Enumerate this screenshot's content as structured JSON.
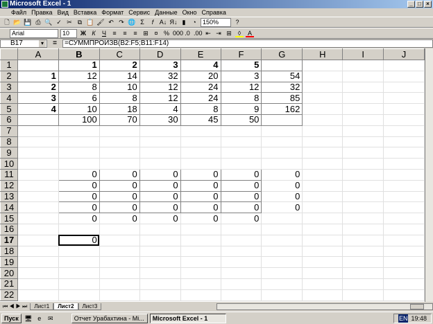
{
  "window": {
    "title": "Microsoft Excel - 1"
  },
  "menu": [
    "Файл",
    "Правка",
    "Вид",
    "Вставка",
    "Формат",
    "Сервис",
    "Данные",
    "Окно",
    "Справка"
  ],
  "toolbar": {
    "zoom": "150%",
    "font": "Arial",
    "font_size": "10"
  },
  "formula_bar": {
    "name_box": "B17",
    "eq": "=",
    "formula": "=СУММПРОИЗВ(B2:F5;B11:F14)"
  },
  "columns": [
    "A",
    "B",
    "C",
    "D",
    "E",
    "F",
    "G",
    "H",
    "I",
    "J"
  ],
  "rows": [
    [
      "",
      "1",
      "2",
      "3",
      "4",
      "5",
      "",
      "",
      "",
      ""
    ],
    [
      "1",
      "12",
      "14",
      "32",
      "20",
      "3",
      "54",
      "",
      "",
      ""
    ],
    [
      "2",
      "8",
      "10",
      "12",
      "24",
      "12",
      "32",
      "",
      "",
      ""
    ],
    [
      "3",
      "6",
      "8",
      "12",
      "24",
      "8",
      "85",
      "",
      "",
      ""
    ],
    [
      "4",
      "10",
      "18",
      "4",
      "8",
      "9",
      "162",
      "",
      "",
      ""
    ],
    [
      "",
      "100",
      "70",
      "30",
      "45",
      "50",
      "",
      "",
      "",
      ""
    ],
    [
      "",
      "",
      "",
      "",
      "",
      "",
      "",
      "",
      "",
      ""
    ],
    [
      "",
      "",
      "",
      "",
      "",
      "",
      "",
      "",
      "",
      ""
    ],
    [
      "",
      "",
      "",
      "",
      "",
      "",
      "",
      "",
      "",
      ""
    ],
    [
      "",
      "",
      "",
      "",
      "",
      "",
      "",
      "",
      "",
      ""
    ],
    [
      "",
      "0",
      "0",
      "0",
      "0",
      "0",
      "0",
      "",
      "",
      ""
    ],
    [
      "",
      "0",
      "0",
      "0",
      "0",
      "0",
      "0",
      "",
      "",
      ""
    ],
    [
      "",
      "0",
      "0",
      "0",
      "0",
      "0",
      "0",
      "",
      "",
      ""
    ],
    [
      "",
      "0",
      "0",
      "0",
      "0",
      "0",
      "0",
      "",
      "",
      ""
    ],
    [
      "",
      "0",
      "0",
      "0",
      "0",
      "0",
      "",
      "",
      "",
      ""
    ],
    [
      "",
      "",
      "",
      "",
      "",
      "",
      "",
      "",
      "",
      ""
    ],
    [
      "",
      "0",
      "",
      "",
      "",
      "",
      "",
      "",
      "",
      ""
    ],
    [
      "",
      "",
      "",
      "",
      "",
      "",
      "",
      "",
      "",
      ""
    ],
    [
      "",
      "",
      "",
      "",
      "",
      "",
      "",
      "",
      "",
      ""
    ],
    [
      "",
      "",
      "",
      "",
      "",
      "",
      "",
      "",
      "",
      ""
    ],
    [
      "",
      "",
      "",
      "",
      "",
      "",
      "",
      "",
      "",
      ""
    ],
    [
      "",
      "",
      "",
      "",
      "",
      "",
      "",
      "",
      "",
      ""
    ]
  ],
  "selected_cell": "B17",
  "sheets": [
    {
      "label": "Лист1"
    },
    {
      "label": "Лист2",
      "active": true
    },
    {
      "label": "Лист3"
    }
  ],
  "taskbar": {
    "start": "Пуск",
    "items": [
      {
        "label": "Отчет Урабахтина - Mi..."
      },
      {
        "label": "Microsoft Excel - 1",
        "active": true
      }
    ],
    "lang": "EN",
    "clock": "19:48"
  }
}
